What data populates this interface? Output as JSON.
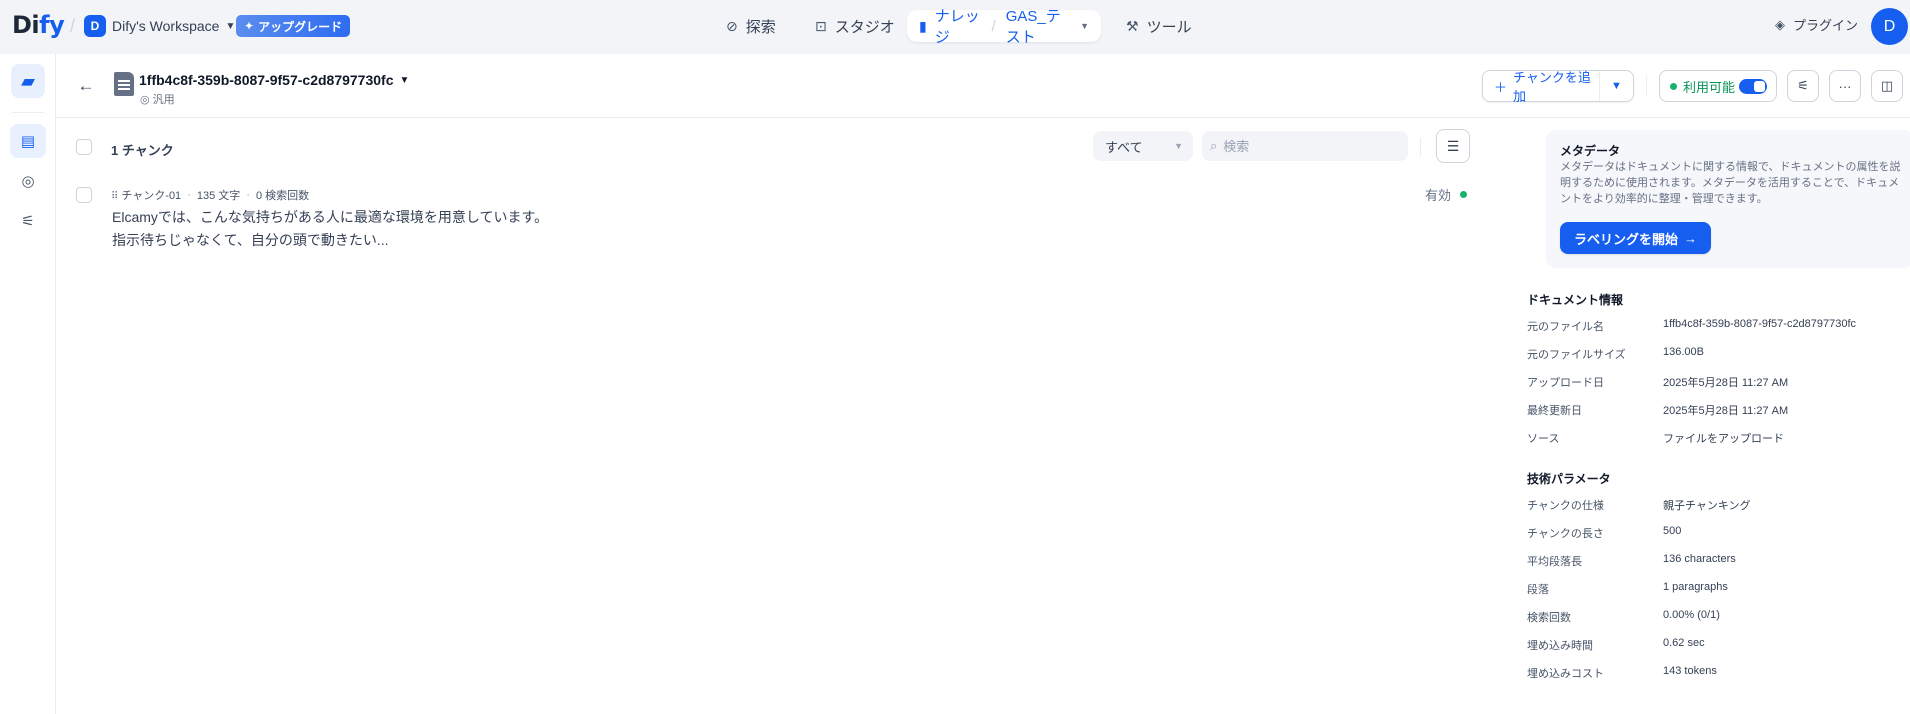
{
  "topbar": {
    "logo": {
      "prefix": "Di",
      "accent": "fy"
    },
    "workspace": {
      "initial": "D",
      "name": "Dify's Workspace"
    },
    "upgrade_label": "アップグレード",
    "nav": {
      "explore": "探索",
      "studio": "スタジオ",
      "knowledge": "ナレッジ",
      "dataset": "GAS_テスト",
      "tools": "ツール"
    },
    "plugin_label": "プラグイン",
    "user_initial": "D"
  },
  "document": {
    "title": "1ffb4c8f-359b-8087-9f57-c2d8797730fc",
    "mode": "汎用",
    "add_chunk_label": "チャンクを追加",
    "status_label": "利用可能",
    "enabled": true
  },
  "list": {
    "count_label": "1 チャンク",
    "filter_value": "すべて",
    "search_placeholder": "検索"
  },
  "chunks": [
    {
      "id": "チャンク-01",
      "chars": "135 文字",
      "hits": "0 検索回数",
      "line1": "Elcamyでは、こんな気持ちがある人に最適な環境を用意しています。",
      "line2": "指示待ちじゃなくて、自分の頭で動きたい...",
      "status": "有効"
    }
  ],
  "metadata": {
    "title": "メタデータ",
    "description": "メタデータはドキュメントに関する情報で、ドキュメントの属性を説明するために使用されます。メタデータを活用することで、ドキュメントをより効率的に整理・管理できます。",
    "button_label": "ラベリングを開始"
  },
  "doc_info": {
    "title": "ドキュメント情報",
    "rows": [
      {
        "key": "元のファイル名",
        "value": "1ffb4c8f-359b-8087-9f57-c2d8797730fc"
      },
      {
        "key": "元のファイルサイズ",
        "value": "136.00B"
      },
      {
        "key": "アップロード日",
        "value": "2025年5月28日 11:27 AM"
      },
      {
        "key": "最終更新日",
        "value": "2025年5月28日 11:27 AM"
      },
      {
        "key": "ソース",
        "value": "ファイルをアップロード"
      }
    ]
  },
  "tech_params": {
    "title": "技術パラメータ",
    "rows": [
      {
        "key": "チャンクの仕様",
        "value": "親子チャンキング"
      },
      {
        "key": "チャンクの長さ",
        "value": "500"
      },
      {
        "key": "平均段落長",
        "value": "136 characters"
      },
      {
        "key": "段落",
        "value": "1 paragraphs"
      },
      {
        "key": "検索回数",
        "value": "0.00% (0/1)"
      },
      {
        "key": "埋め込み時間",
        "value": "0.62 sec"
      },
      {
        "key": "埋め込みコスト",
        "value": "143 tokens"
      }
    ]
  },
  "colors": {
    "accent": "#155eef",
    "status_green": "#17b26a",
    "background": "#f2f4f7"
  }
}
